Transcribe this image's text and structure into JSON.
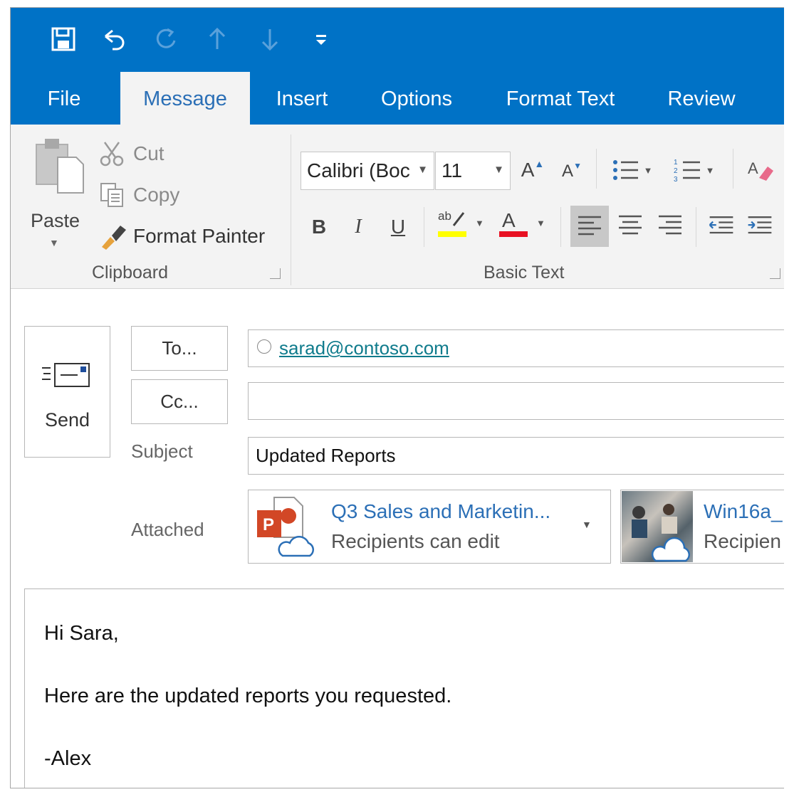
{
  "quick_access": [
    {
      "name": "save-icon"
    },
    {
      "name": "undo-icon"
    },
    {
      "name": "redo-icon"
    },
    {
      "name": "up-arrow-icon"
    },
    {
      "name": "down-arrow-icon"
    },
    {
      "name": "customize-qat-icon"
    }
  ],
  "tabs": [
    "File",
    "Message",
    "Insert",
    "Options",
    "Format Text",
    "Review"
  ],
  "active_tab": "Message",
  "ribbon": {
    "clipboard": {
      "paste_label": "Paste",
      "cut_label": "Cut",
      "copy_label": "Copy",
      "format_painter_label": "Format Painter",
      "group_label": "Clipboard"
    },
    "basic_text": {
      "font_name": "Calibri (Boc",
      "font_size": "11",
      "group_label": "Basic Text",
      "bold": "B",
      "italic": "I",
      "underline": "U",
      "highlight_color": "#ffff00",
      "font_color": "#e81123"
    }
  },
  "compose": {
    "send_label": "Send",
    "to_button": "To...",
    "cc_button": "Cc...",
    "subject_label": "Subject",
    "attached_label": "Attached",
    "to_recipient": "sarad@contoso.com",
    "cc_value": "",
    "subject_value": "Updated Reports",
    "attachments": [
      {
        "title": "Q3 Sales and Marketin...",
        "subtitle": "Recipients can edit",
        "icon": "powerpoint-cloud-icon"
      },
      {
        "title": "Win16a_",
        "subtitle": "Recipien",
        "icon": "image-cloud-icon"
      }
    ]
  },
  "message_body": [
    "Hi Sara,",
    "Here are the updated reports you requested.",
    "-Alex"
  ],
  "colors": {
    "accent": "#0072c6",
    "ribbon_bg": "#f3f3f3",
    "active_tab_text": "#2b6fb6",
    "link": "#0f7b8c"
  }
}
